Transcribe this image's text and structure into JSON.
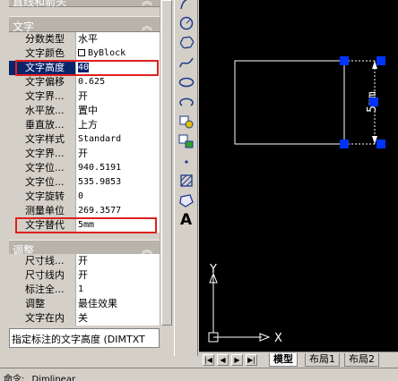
{
  "palette": {
    "sections": {
      "lines_arrows": "直线和箭头",
      "text": "文字",
      "fit": "调整"
    },
    "collapse_glyph": "︽",
    "text_rows": [
      {
        "name": "分数类型",
        "value": "水平"
      },
      {
        "name": "文字颜色",
        "value": "ByBlock"
      },
      {
        "name": "文字高度",
        "value": "40"
      },
      {
        "name": "文字偏移",
        "value": "0.625"
      },
      {
        "name": "文字界...",
        "value": "开"
      },
      {
        "name": "水平放...",
        "value": "置中"
      },
      {
        "name": "垂直放...",
        "value": "上方"
      },
      {
        "name": "文字样式",
        "value": "Standard"
      },
      {
        "name": "文字界...",
        "value": "开"
      },
      {
        "name": "文字位...",
        "value": "940.5191"
      },
      {
        "name": "文字位...",
        "value": "535.9853"
      },
      {
        "name": "文字旋转",
        "value": "0"
      },
      {
        "name": "测量单位",
        "value": "269.3577"
      },
      {
        "name": "文字替代",
        "value": "5mm"
      }
    ],
    "fit_rows": [
      {
        "name": "尺寸线...",
        "value": "开"
      },
      {
        "name": "尺寸线内",
        "value": "开"
      },
      {
        "name": "标注全...",
        "value": "1"
      },
      {
        "name": "调整",
        "value": "最佳效果"
      },
      {
        "name": "文字在内",
        "value": "关"
      }
    ],
    "description": "指定标注的文字高度 (DIMTXT"
  },
  "toolbar": {
    "tools": [
      "arc-icon",
      "circle-icon",
      "revision-cloud-icon",
      "spline-icon",
      "ellipse-icon",
      "ellipse-arc-icon",
      "insert-block-icon",
      "make-block-icon",
      "point-icon",
      "hatch-icon",
      "region-icon",
      "multiline-text-icon"
    ],
    "text_tool_label": "A"
  },
  "canvas": {
    "dimension_text": "5mm",
    "ucs_x": "X",
    "ucs_y": "Y",
    "background": "#000000",
    "geometry_color": "#ffffff",
    "grip_color": "#0033ff"
  },
  "layout_tabs": {
    "nav": [
      "|◀",
      "◀",
      "▶",
      "▶|"
    ],
    "tabs": [
      "模型",
      "布局1",
      "布局2"
    ],
    "active": "模型"
  },
  "statusbar": {
    "text": "命令: _Dimlinear"
  },
  "highlight_color": "#e02020"
}
